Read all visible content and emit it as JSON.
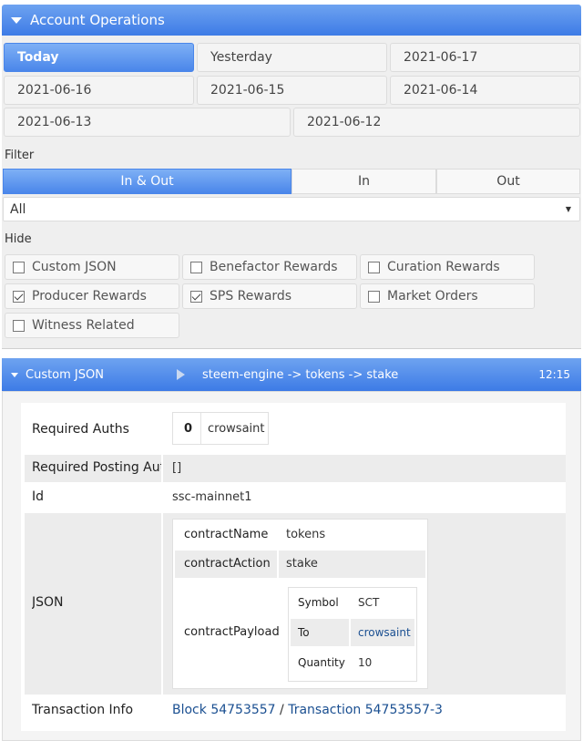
{
  "header": {
    "title": "Account Operations"
  },
  "dates": [
    "Today",
    "Yesterday",
    "2021-06-17",
    "2021-06-16",
    "2021-06-15",
    "2021-06-14",
    "2021-06-13",
    "2021-06-12"
  ],
  "filter": {
    "label": "Filter",
    "tabs": [
      "In & Out",
      "In",
      "Out"
    ],
    "select_value": "All"
  },
  "hide": {
    "label": "Hide",
    "options": [
      {
        "label": "Custom JSON",
        "checked": false
      },
      {
        "label": "Benefactor Rewards",
        "checked": false
      },
      {
        "label": "Curation Rewards",
        "checked": false
      },
      {
        "label": "Producer Rewards",
        "checked": true
      },
      {
        "label": "SPS Rewards",
        "checked": true
      },
      {
        "label": "Market Orders",
        "checked": false
      },
      {
        "label": "Witness Related",
        "checked": false
      }
    ]
  },
  "operation": {
    "type": "Custom JSON",
    "path": "steem-engine -> tokens -> stake",
    "time": "12:15",
    "required_auths_label": "Required Auths",
    "required_auths_index": "0",
    "required_auths_value": "crowsaint",
    "required_posting_label": "Required Posting Auths",
    "required_posting_value": "[]",
    "id_label": "Id",
    "id_value": "ssc-mainnet1",
    "json_label": "JSON",
    "json": {
      "contractName_label": "contractName",
      "contractName": "tokens",
      "contractAction_label": "contractAction",
      "contractAction": "stake",
      "contractPayload_label": "contractPayload",
      "payload": {
        "symbol_label": "Symbol",
        "symbol": "SCT",
        "to_label": "To",
        "to": "crowsaint",
        "quantity_label": "Quantity",
        "quantity": "10"
      }
    },
    "tx_label": "Transaction Info",
    "block_link": "Block 54753557",
    "separator": "/",
    "tx_link": "Transaction 54753557-3"
  },
  "colors": {
    "accent": "#4a86ea",
    "link": "#1a4f91"
  }
}
